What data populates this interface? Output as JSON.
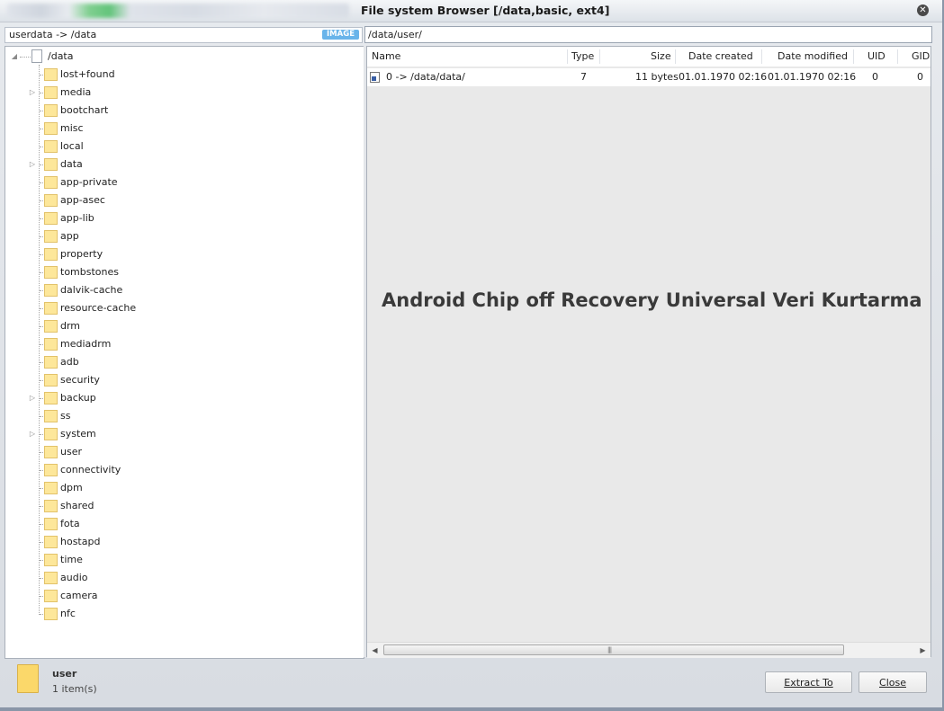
{
  "window": {
    "title": "File system Browser [/data,basic, ext4]"
  },
  "left_path": {
    "value": "userdata -> /data",
    "badge": "IMAGE"
  },
  "right_path": {
    "value": "/data/user/"
  },
  "tree": {
    "root": "/data",
    "items": [
      {
        "label": "lost+found",
        "expandable": false
      },
      {
        "label": "media",
        "expandable": true
      },
      {
        "label": "bootchart",
        "expandable": false
      },
      {
        "label": "misc",
        "expandable": false
      },
      {
        "label": "local",
        "expandable": false
      },
      {
        "label": "data",
        "expandable": true
      },
      {
        "label": "app-private",
        "expandable": false
      },
      {
        "label": "app-asec",
        "expandable": false
      },
      {
        "label": "app-lib",
        "expandable": false
      },
      {
        "label": "app",
        "expandable": false
      },
      {
        "label": "property",
        "expandable": false
      },
      {
        "label": "tombstones",
        "expandable": false
      },
      {
        "label": "dalvik-cache",
        "expandable": false
      },
      {
        "label": "resource-cache",
        "expandable": false
      },
      {
        "label": "drm",
        "expandable": false
      },
      {
        "label": "mediadrm",
        "expandable": false
      },
      {
        "label": "adb",
        "expandable": false
      },
      {
        "label": "security",
        "expandable": false
      },
      {
        "label": "backup",
        "expandable": true
      },
      {
        "label": "ss",
        "expandable": false
      },
      {
        "label": "system",
        "expandable": true
      },
      {
        "label": "user",
        "expandable": false
      },
      {
        "label": "connectivity",
        "expandable": false
      },
      {
        "label": "dpm",
        "expandable": false
      },
      {
        "label": "shared",
        "expandable": false
      },
      {
        "label": "fota",
        "expandable": false
      },
      {
        "label": "hostapd",
        "expandable": false
      },
      {
        "label": "time",
        "expandable": false
      },
      {
        "label": "audio",
        "expandable": false
      },
      {
        "label": "camera",
        "expandable": false
      },
      {
        "label": "nfc",
        "expandable": false
      }
    ]
  },
  "list": {
    "columns": [
      "Name",
      "Type",
      "Size",
      "Date created",
      "Date modified",
      "UID",
      "GID"
    ],
    "rows": [
      {
        "name": "0 -> /data/data/",
        "type": "7",
        "size": "11 bytes",
        "created": "01.01.1970 02:16",
        "modified": "01.01.1970 02:16",
        "uid": "0",
        "gid": "0",
        "icon": "symlink-icon"
      }
    ]
  },
  "watermark": "Android Chip off Recovery Universal Veri Kurtarma",
  "status": {
    "name": "user",
    "count": "1 item(s)"
  },
  "buttons": {
    "extract_label": "Extract To",
    "close_label": "Close"
  },
  "colors": {
    "folder": "#fde79a",
    "badge": "#69b4ea",
    "list_background": "#e9e9e9"
  }
}
